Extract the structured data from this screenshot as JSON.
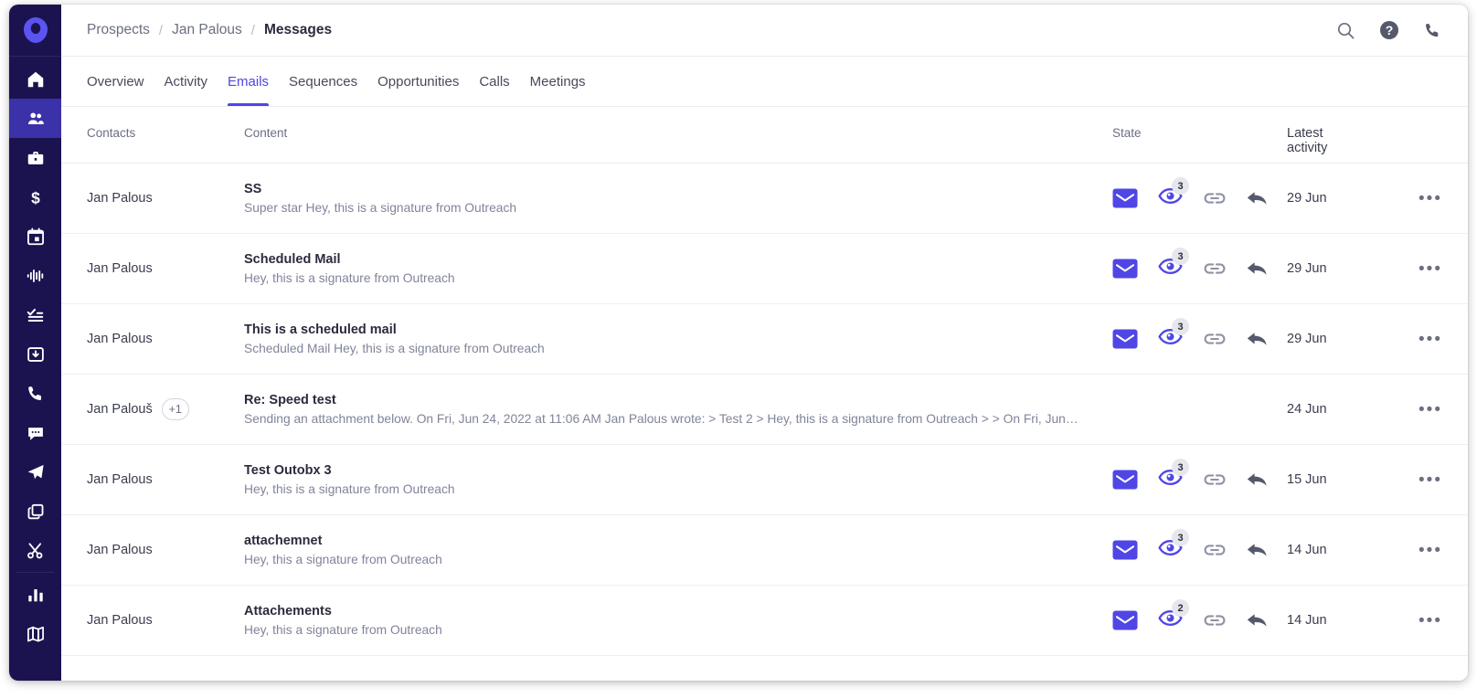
{
  "brand": {
    "logo_name": "outreach-logo",
    "accent": "#4f46e5",
    "sidebar_bg": "#1b1350",
    "active_nav_bg": "#3b31a8"
  },
  "sidebar": {
    "items": [
      {
        "icon": "home-icon",
        "name": "home",
        "active": false
      },
      {
        "icon": "people-icon",
        "name": "prospects",
        "active": true
      },
      {
        "icon": "briefcase-icon",
        "name": "accounts",
        "active": false
      },
      {
        "icon": "dollar-icon",
        "name": "opportunities",
        "active": false
      },
      {
        "icon": "calendar-icon",
        "name": "meetings",
        "active": false
      },
      {
        "icon": "waveform-icon",
        "name": "voice",
        "active": false
      },
      {
        "icon": "task-list-icon",
        "name": "tasks",
        "active": false
      },
      {
        "icon": "inbox-icon",
        "name": "inbox",
        "active": false
      },
      {
        "icon": "phone-icon",
        "name": "calls",
        "active": false
      },
      {
        "icon": "chat-bubble-icon",
        "name": "chat",
        "active": false
      },
      {
        "icon": "paper-plane-icon",
        "name": "sequences",
        "active": false
      },
      {
        "icon": "copy-icon",
        "name": "templates",
        "active": false
      },
      {
        "icon": "scissors-icon",
        "name": "snippets",
        "active": false
      },
      {
        "icon": "bar-chart-icon",
        "name": "reports",
        "active": false
      },
      {
        "icon": "map-icon",
        "name": "governance",
        "active": false
      }
    ]
  },
  "header": {
    "breadcrumbs": [
      {
        "label": "Prospects",
        "current": false
      },
      {
        "label": "Jan Palous",
        "current": false
      },
      {
        "label": "Messages",
        "current": true
      }
    ],
    "separator": "/",
    "icons": [
      {
        "name": "search-icon"
      },
      {
        "name": "help-icon"
      },
      {
        "name": "phone-icon"
      }
    ]
  },
  "tabs": [
    {
      "label": "Overview",
      "active": false
    },
    {
      "label": "Activity",
      "active": false
    },
    {
      "label": "Emails",
      "active": true
    },
    {
      "label": "Sequences",
      "active": false
    },
    {
      "label": "Opportunities",
      "active": false
    },
    {
      "label": "Calls",
      "active": false
    },
    {
      "label": "Meetings",
      "active": false
    }
  ],
  "table": {
    "columns": {
      "contacts": "Contacts",
      "content": "Content",
      "state": "State",
      "latest_activity": "Latest\nactivity",
      "latest_activity_line1": "Latest",
      "latest_activity_line2": "activity"
    },
    "menu_glyph": "•••",
    "rows": [
      {
        "contact": "Jan Palous",
        "extra_contacts": null,
        "subject": "SS",
        "preview": "Super star Hey, this is a signature from Outreach",
        "has_state": true,
        "view_count": "3",
        "date": "29 Jun"
      },
      {
        "contact": "Jan Palous",
        "extra_contacts": null,
        "subject": "Scheduled Mail",
        "preview": "Hey, this is a signature from Outreach",
        "has_state": true,
        "view_count": "3",
        "date": "29 Jun"
      },
      {
        "contact": "Jan Palous",
        "extra_contacts": null,
        "subject": "This is a scheduled mail",
        "preview": "Scheduled Mail Hey, this is a signature from Outreach",
        "has_state": true,
        "view_count": "3",
        "date": "29 Jun"
      },
      {
        "contact": "Jan Palouš",
        "extra_contacts": "+1",
        "subject": "Re: Speed test",
        "preview": "Sending an attachment below. On Fri, Jun 24, 2022 at 11:06 AM Jan Palous wrote: > Test 2 > Hey, this is a signature from Outreach > > On Fri, Jun…",
        "has_state": false,
        "view_count": "",
        "date": "24 Jun"
      },
      {
        "contact": "Jan Palous",
        "extra_contacts": null,
        "subject": "Test Outobx 3",
        "preview": "Hey, this is a signature from Outreach",
        "has_state": true,
        "view_count": "3",
        "date": "15 Jun"
      },
      {
        "contact": "Jan Palous",
        "extra_contacts": null,
        "subject": "attachemnet",
        "preview": "Hey, this a signature from Outreach",
        "has_state": true,
        "view_count": "3",
        "date": "14 Jun"
      },
      {
        "contact": "Jan Palous",
        "extra_contacts": null,
        "subject": "Attachements",
        "preview": "Hey, this a signature from Outreach",
        "has_state": true,
        "view_count": "2",
        "date": "14 Jun"
      }
    ],
    "state_icons": [
      {
        "name": "envelope-icon"
      },
      {
        "name": "eye-icon"
      },
      {
        "name": "link-icon"
      },
      {
        "name": "reply-icon"
      }
    ]
  }
}
